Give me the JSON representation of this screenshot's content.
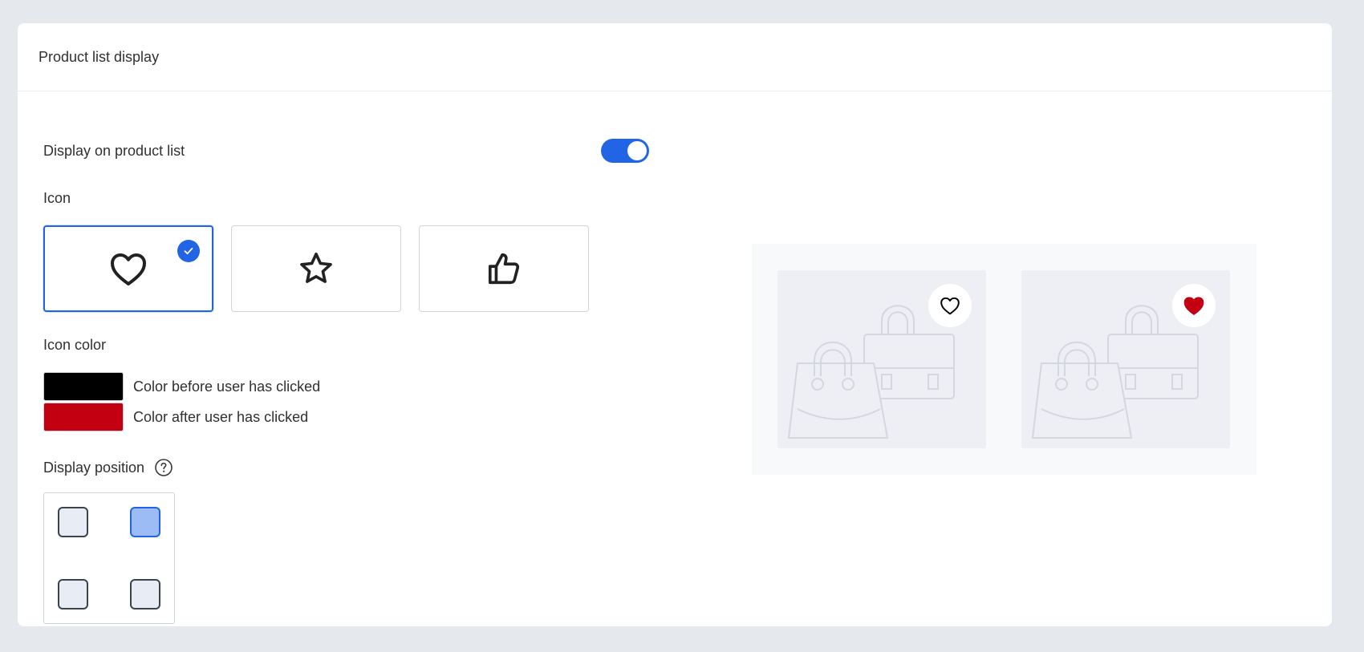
{
  "panel": {
    "title": "Product list display"
  },
  "settings": {
    "display_on_list": {
      "label": "Display on product list",
      "enabled": true
    },
    "icon": {
      "label": "Icon",
      "options": [
        {
          "name": "heart-icon",
          "selected": true
        },
        {
          "name": "star-icon",
          "selected": false
        },
        {
          "name": "thumbs-up-icon",
          "selected": false
        }
      ]
    },
    "icon_color": {
      "label": "Icon color",
      "before": {
        "label": "Color before user has clicked",
        "color": "#000000"
      },
      "after": {
        "label": "Color after user has clicked",
        "color": "#c20012"
      }
    },
    "display_position": {
      "label": "Display position",
      "selected": "top-right",
      "options": [
        "top-left",
        "top-right",
        "bottom-left",
        "bottom-right"
      ]
    }
  },
  "colors": {
    "accent": "#2264e6",
    "background": "#e5e8ec"
  },
  "preview": {
    "cards": [
      {
        "icon": "heart-outline-icon",
        "state": "before-click"
      },
      {
        "icon": "heart-filled-icon",
        "state": "after-click"
      }
    ]
  }
}
